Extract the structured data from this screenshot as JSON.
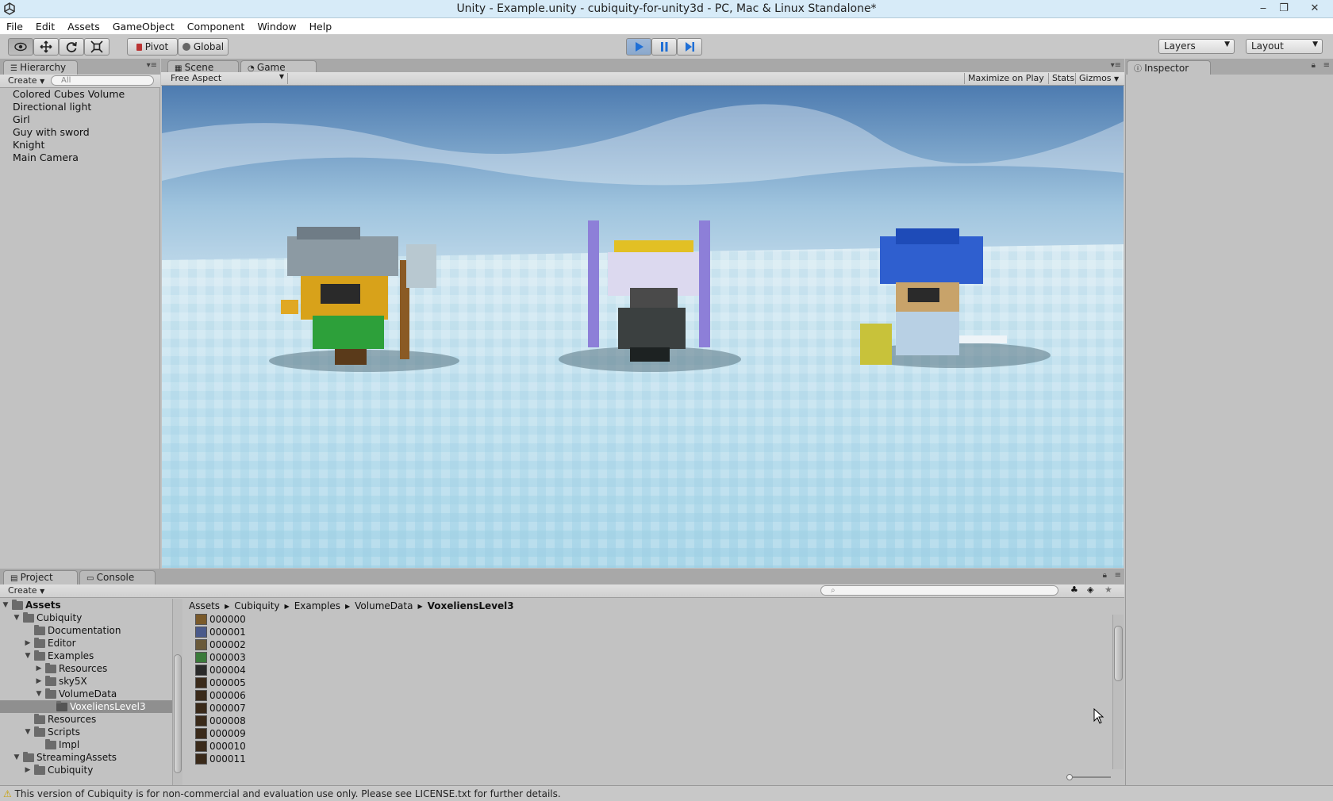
{
  "window": {
    "title": "Unity - Example.unity - cubiquity-for-unity3d - PC, Mac & Linux Standalone*",
    "minimize": "‒",
    "restore": "❐",
    "close": "✕"
  },
  "menu": [
    "File",
    "Edit",
    "Assets",
    "GameObject",
    "Component",
    "Window",
    "Help"
  ],
  "toolbar": {
    "pivot_label": "Pivot",
    "global_label": "Global",
    "layers_label": "Layers",
    "layout_label": "Layout"
  },
  "hierarchy": {
    "tab_label": "Hierarchy",
    "create_label": "Create",
    "search_placeholder": "All",
    "items": [
      "Colored Cubes Volume",
      "Directional light",
      "Girl",
      "Guy with sword",
      "Knight",
      "Main Camera"
    ]
  },
  "views": {
    "scene_tab": "Scene",
    "game_tab": "Game",
    "aspect_label": "Free Aspect",
    "maximize_label": "Maximize on Play",
    "stats_label": "Stats",
    "gizmos_label": "Gizmos"
  },
  "inspector": {
    "tab_label": "Inspector"
  },
  "project": {
    "tab_label": "Project",
    "console_tab": "Console",
    "create_label": "Create",
    "breadcrumb": [
      "Assets",
      "Cubiquity",
      "Examples",
      "VolumeData",
      "VoxeliensLevel3"
    ],
    "tree": [
      {
        "label": "Assets",
        "bold": true
      },
      {
        "label": "Cubiquity"
      },
      {
        "label": "Documentation"
      },
      {
        "label": "Editor"
      },
      {
        "label": "Examples"
      },
      {
        "label": "Resources"
      },
      {
        "label": "sky5X"
      },
      {
        "label": "VolumeData"
      },
      {
        "label": "VoxeliensLevel3",
        "selected": true
      },
      {
        "label": "Resources"
      },
      {
        "label": "Scripts"
      },
      {
        "label": "Impl"
      },
      {
        "label": "StreamingAssets"
      },
      {
        "label": "Cubiquity"
      }
    ],
    "assets": [
      "000000",
      "000001",
      "000002",
      "000003",
      "000004",
      "000005",
      "000006",
      "000007",
      "000008",
      "000009",
      "000010",
      "000011"
    ]
  },
  "status": {
    "message": "This version of Cubiquity is for non-commercial and evaluation use only. Please see LICENSE.txt for further details."
  },
  "colors": {
    "play_active": "#4a86d8",
    "selection": "#3d6eb5"
  }
}
